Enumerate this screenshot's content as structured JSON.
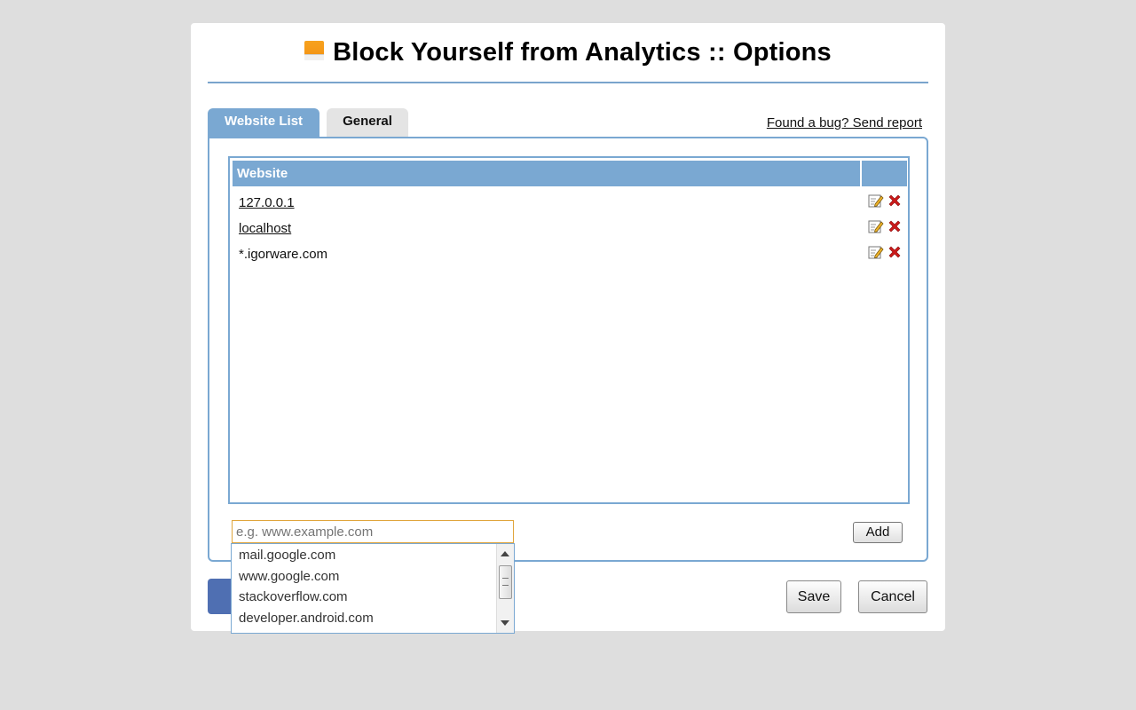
{
  "header": {
    "title": "Block Yourself from Analytics :: Options"
  },
  "tabs": [
    {
      "label": "Website List",
      "active": true
    },
    {
      "label": "General",
      "active": false
    }
  ],
  "bug_link": "Found a bug? Send report",
  "list": {
    "column_header": "Website",
    "rows": [
      {
        "site": "127.0.0.1"
      },
      {
        "site": "localhost"
      },
      {
        "site": "*.igorware.com"
      }
    ]
  },
  "add": {
    "placeholder": "e.g. www.example.com",
    "button_label": "Add"
  },
  "autocomplete": {
    "items": [
      "mail.google.com",
      "www.google.com",
      "stackoverflow.com",
      "developer.android.com"
    ]
  },
  "footer": {
    "save_label": "Save",
    "cancel_label": "Cancel"
  },
  "colors": {
    "accent": "#7aa8d2",
    "delete": "#cc1a1a",
    "logo": "#f39112"
  },
  "icons": {
    "edit": "edit-icon",
    "delete": "delete-icon",
    "logo": "analytics-logo-icon",
    "facebook": "facebook-icon"
  }
}
